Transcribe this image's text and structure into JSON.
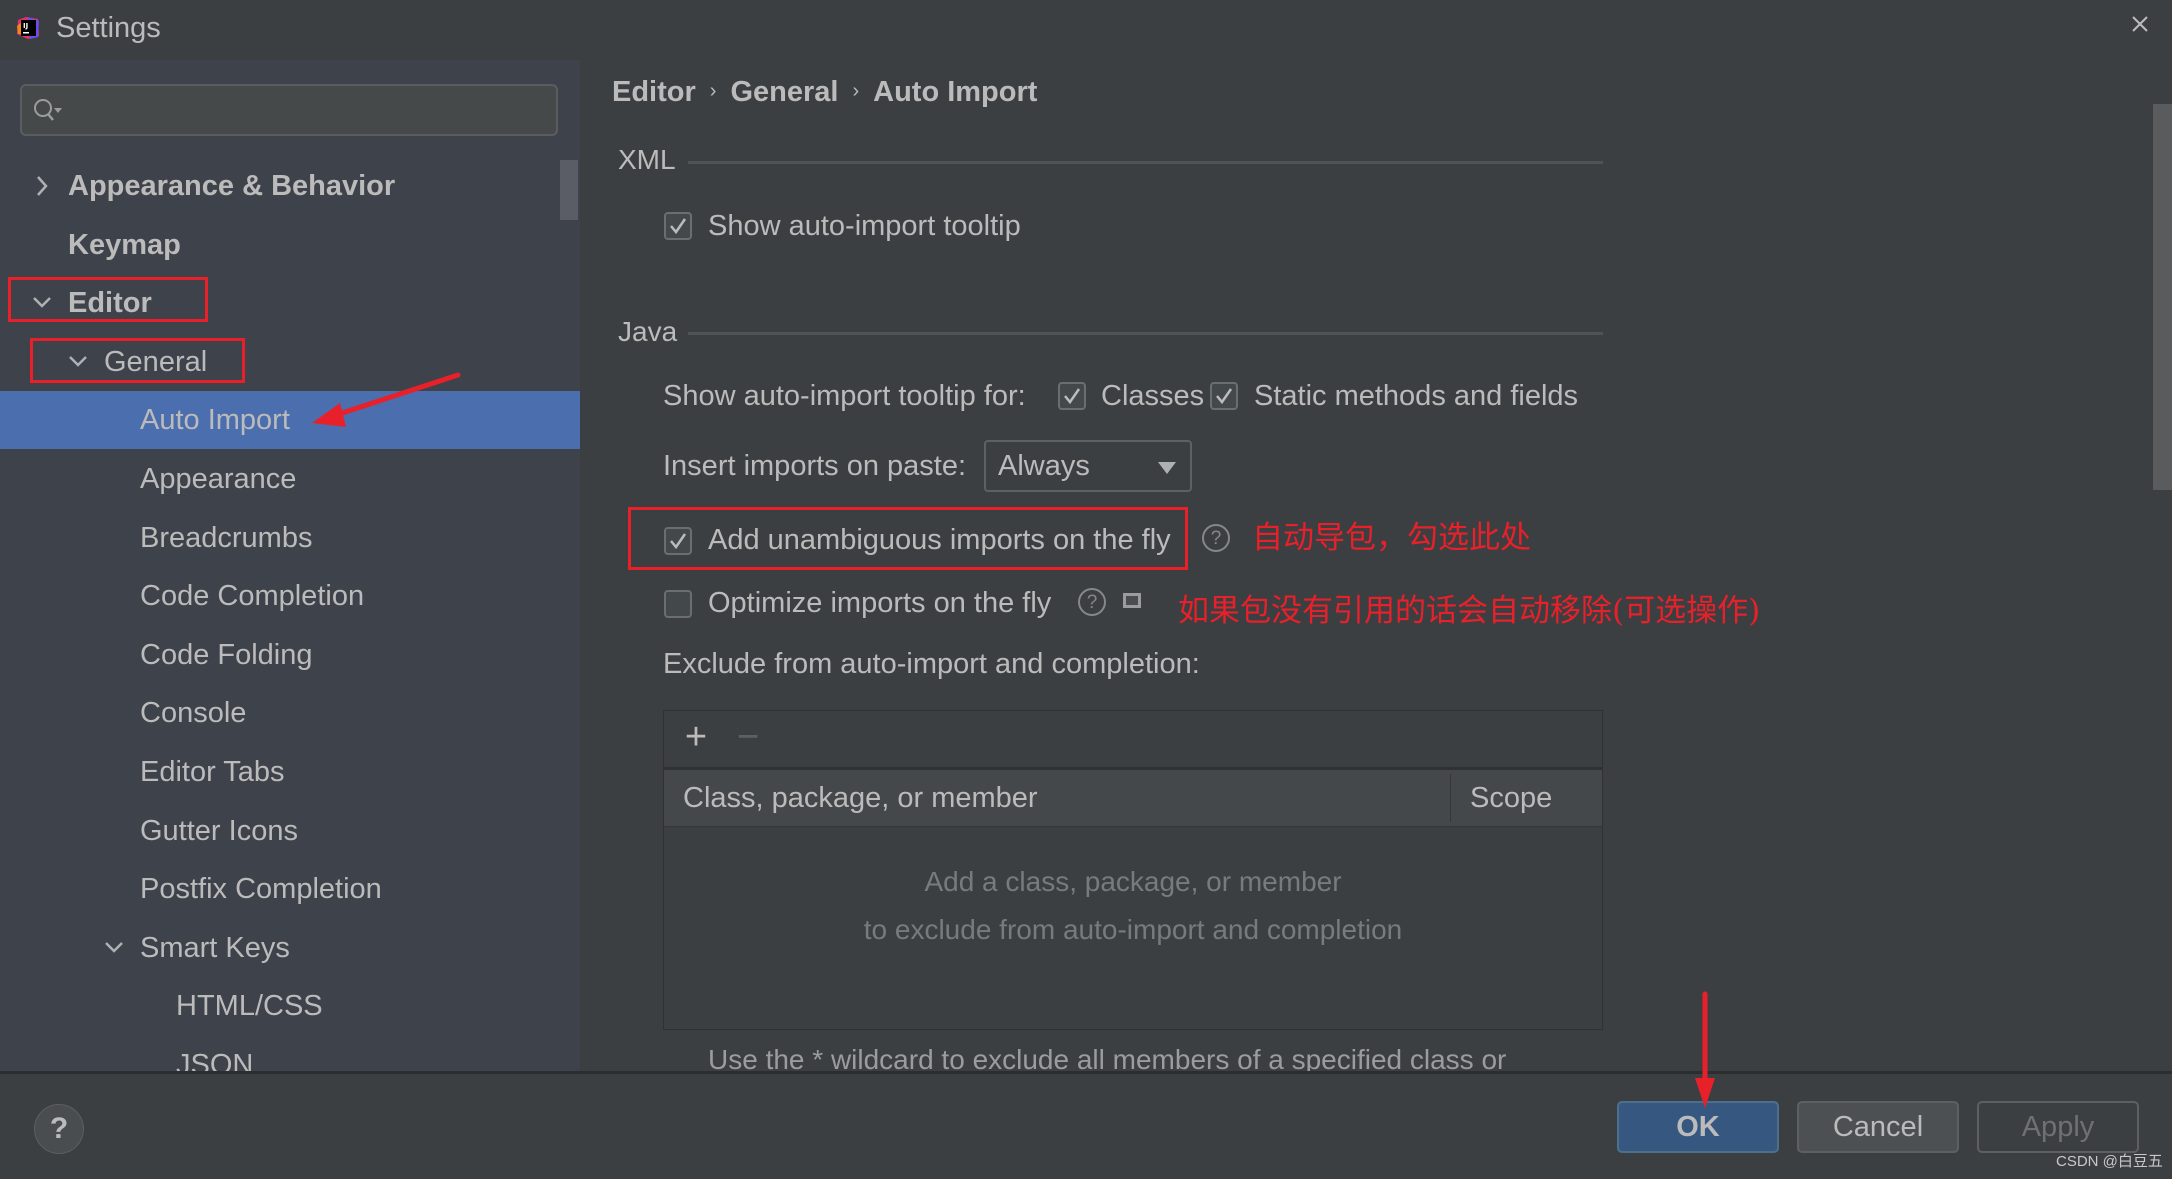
{
  "window": {
    "title": "Settings",
    "app_icon": "intellij-idea-icon",
    "close_icon": "close-icon"
  },
  "sidebar": {
    "search": {
      "placeholder": "",
      "value": "",
      "icon": "search-icon"
    },
    "items": [
      {
        "label": "Appearance & Behavior",
        "level": 0,
        "bold": true,
        "expander": "collapsed"
      },
      {
        "label": "Keymap",
        "level": 0,
        "bold": true,
        "expander": "none"
      },
      {
        "label": "Editor",
        "level": 0,
        "bold": true,
        "expander": "expanded"
      },
      {
        "label": "General",
        "level": 1,
        "bold": false,
        "expander": "expanded"
      },
      {
        "label": "Auto Import",
        "level": 2,
        "bold": false,
        "expander": "none",
        "selected": true
      },
      {
        "label": "Appearance",
        "level": 2,
        "bold": false,
        "expander": "none"
      },
      {
        "label": "Breadcrumbs",
        "level": 2,
        "bold": false,
        "expander": "none"
      },
      {
        "label": "Code Completion",
        "level": 2,
        "bold": false,
        "expander": "none"
      },
      {
        "label": "Code Folding",
        "level": 2,
        "bold": false,
        "expander": "none"
      },
      {
        "label": "Console",
        "level": 2,
        "bold": false,
        "expander": "none"
      },
      {
        "label": "Editor Tabs",
        "level": 2,
        "bold": false,
        "expander": "none"
      },
      {
        "label": "Gutter Icons",
        "level": 2,
        "bold": false,
        "expander": "none"
      },
      {
        "label": "Postfix Completion",
        "level": 2,
        "bold": false,
        "expander": "none"
      },
      {
        "label": "Smart Keys",
        "level": 2,
        "bold": false,
        "expander": "expanded"
      },
      {
        "label": "HTML/CSS",
        "level": 3,
        "bold": false,
        "expander": "none"
      },
      {
        "label": "JSON",
        "level": 3,
        "bold": false,
        "expander": "none"
      }
    ]
  },
  "breadcrumb": [
    "Editor",
    "General",
    "Auto Import"
  ],
  "breadcrumb_separator": "›",
  "xml_section": {
    "title": "XML",
    "show_tooltip": {
      "label": "Show auto-import tooltip",
      "checked": true
    }
  },
  "java_section": {
    "title": "Java",
    "tooltip_for_label": "Show auto-import tooltip for:",
    "classes": {
      "label": "Classes",
      "checked": true
    },
    "static_members": {
      "label": "Static methods and fields",
      "checked": true
    },
    "insert_on_paste": {
      "label": "Insert imports on paste:",
      "value": "Always"
    },
    "add_unambiguous": {
      "label": "Add unambiguous imports on the fly",
      "checked": true,
      "help": "?"
    },
    "optimize_on_fly": {
      "label": "Optimize imports on the fly",
      "checked": false,
      "help": "?"
    },
    "exclude_label": "Exclude from auto-import and completion:",
    "exclude_table": {
      "add_label": "+",
      "remove_label": "−",
      "columns": [
        "Class, package, or member",
        "Scope"
      ],
      "rows": [],
      "empty_line1": "Add a class, package, or member",
      "empty_line2": "to exclude from auto-import and completion"
    },
    "hint": "Use the * wildcard to exclude all members of a specified class or"
  },
  "annotations": {
    "auto_import_note": "自动导包，勾选此处",
    "optimize_note": "如果包没有引用的话会自动移除(可选操作)",
    "color": "#e8202a"
  },
  "footer": {
    "help_label": "?",
    "ok_label": "OK",
    "cancel_label": "Cancel",
    "apply_label": "Apply",
    "watermark": "CSDN @白豆五"
  },
  "colors": {
    "selection": "#4b6eaf",
    "ok_button": "#365880",
    "background": "#3c3f41",
    "sidebar": "#3e424a"
  }
}
